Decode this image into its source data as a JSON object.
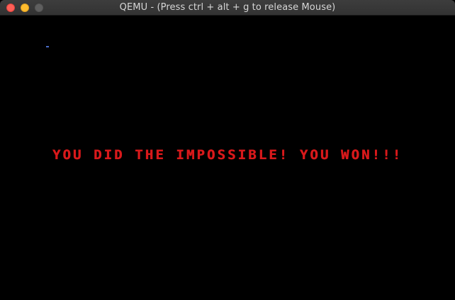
{
  "window": {
    "title": "QEMU - (Press ctrl + alt + g to release Mouse)"
  },
  "screen": {
    "message": "YOU DID THE IMPOSSIBLE! YOU WON!!!"
  },
  "colors": {
    "background": "#000000",
    "message": "#d8191b",
    "titlebar": "#393939",
    "close": "#ff5f57",
    "minimize": "#febc2e",
    "zoom_disabled": "#5f5f5f"
  }
}
